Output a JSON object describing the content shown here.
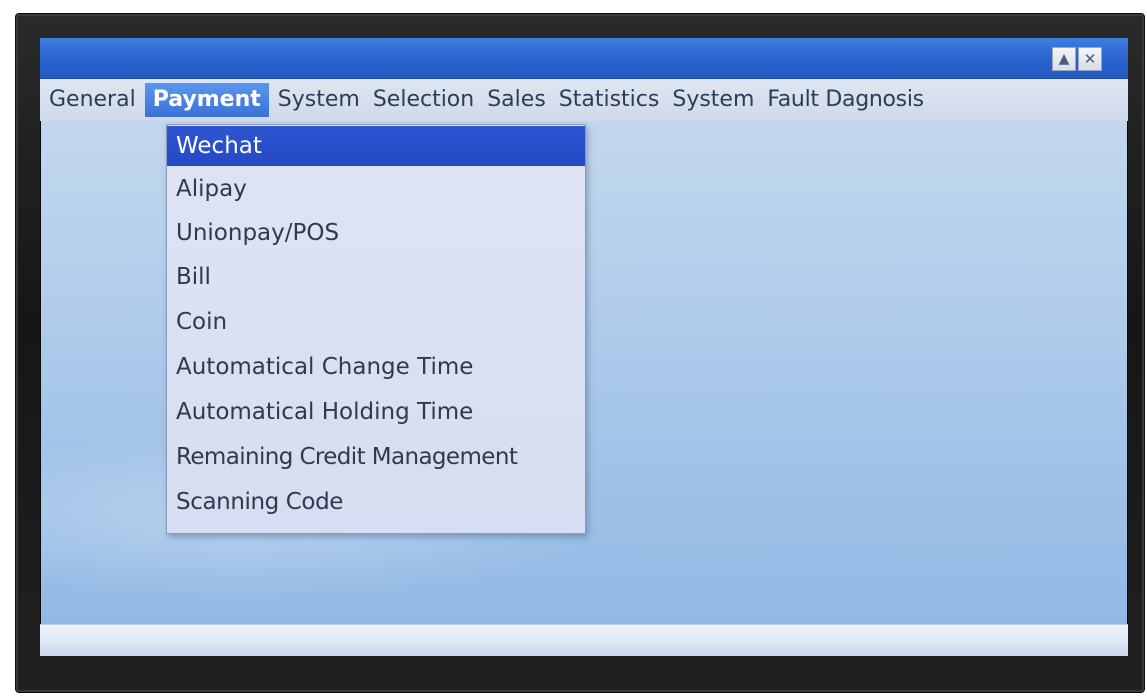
{
  "window": {
    "buttons": {
      "scroll_up_label": "▲",
      "close_label": "✕"
    }
  },
  "menubar": {
    "items": [
      {
        "label": "General",
        "active": false
      },
      {
        "label": "Payment",
        "active": true
      },
      {
        "label": "System",
        "active": false
      },
      {
        "label": "Selection",
        "active": false
      },
      {
        "label": "Sales",
        "active": false
      },
      {
        "label": "Statistics",
        "active": false
      },
      {
        "label": "System",
        "active": false
      },
      {
        "label": "Fault Dagnosis",
        "active": false
      }
    ]
  },
  "payment_menu": {
    "selected_index": 0,
    "items": [
      {
        "label": "Wechat"
      },
      {
        "label": "Alipay"
      },
      {
        "label": "Unionpay/POS"
      },
      {
        "label": "Bill"
      },
      {
        "label": "Coin"
      },
      {
        "label": "Automatical Change Time"
      },
      {
        "label": "Automatical Holding Time"
      },
      {
        "label": "Remaining Credit Management"
      },
      {
        "label": "Scanning Code"
      }
    ]
  },
  "colors": {
    "titlebar": "#2a62cc",
    "menu_active": "#3a72d6",
    "dropdown_selected": "#2449c4",
    "screen_background": "#a6c6e9"
  },
  "icons": {
    "scroll_up": "triangle-up-icon",
    "close": "close-icon"
  }
}
